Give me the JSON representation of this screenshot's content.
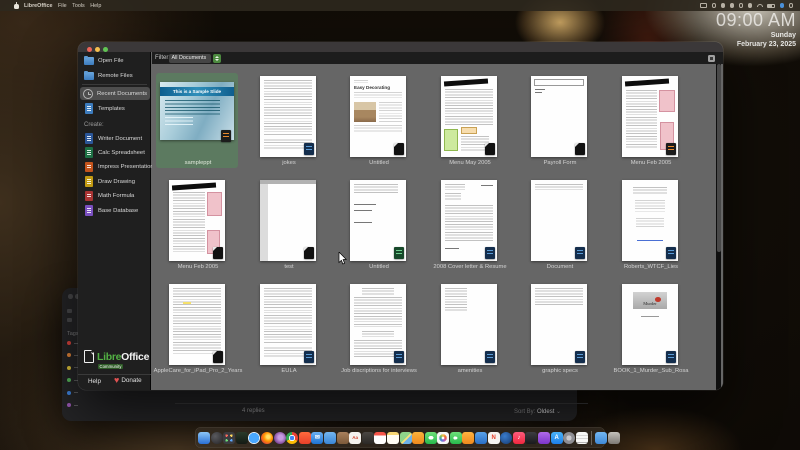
{
  "menu_bar": {
    "items": [
      "LibreOffice",
      "File",
      "Tools",
      "Help"
    ],
    "status_icons": [
      "rect",
      "ring",
      "circ",
      "circ",
      "ring",
      "circ",
      "wifi",
      "batt",
      "blue",
      "ring"
    ]
  },
  "clock": {
    "time": "09:00 AM",
    "day": "Sunday",
    "date": "February 23, 2025"
  },
  "background_window": {
    "tags_label": "Tags",
    "tag_colors": [
      "#e0443e",
      "#e8883a",
      "#e5c93d",
      "#58b95c",
      "#3f84e0",
      "#9b59b6"
    ],
    "replies": "4 replies",
    "sort_label": "Sort By:",
    "sort_value": "Oldest",
    "sort_caret": "⌄"
  },
  "window": {
    "filter": {
      "label": "Filter:",
      "value": "All Documents"
    },
    "sidebar": {
      "items": [
        {
          "label": "Open File",
          "icon": "folder"
        },
        {
          "label": "Remote Files",
          "icon": "folder"
        },
        {
          "label": "Recent Documents",
          "icon": "clock",
          "selected": true
        },
        {
          "label": "Templates",
          "icon": "doc",
          "color": "#3c7cbe"
        }
      ],
      "create_label": "Create:",
      "create_items": [
        {
          "label": "Writer Document",
          "color": "#2a5699"
        },
        {
          "label": "Calc Spreadsheet",
          "color": "#1d7044"
        },
        {
          "label": "Impress Presentation",
          "color": "#c4541c"
        },
        {
          "label": "Draw Drawing",
          "color": "#c29a12"
        },
        {
          "label": "Math Formula",
          "color": "#a83434"
        },
        {
          "label": "Base Database",
          "color": "#7a4fc0"
        }
      ],
      "logo_green": "Libre",
      "logo_white": "Office",
      "community": "Community",
      "help_label": "Help",
      "donate_label": "Donate"
    },
    "documents": [
      {
        "name": "sampleppt",
        "variant": "slide",
        "badge": "impress",
        "selected": true,
        "text": "This is a Sample Slide"
      },
      {
        "name": "jokes",
        "variant": "dense",
        "badge": "writer"
      },
      {
        "name": "Untitled",
        "variant": "easydeco",
        "badge": "plain",
        "text": "Easy Decorating"
      },
      {
        "name": "Menu May 2005",
        "variant": "menumay",
        "badge": "plain"
      },
      {
        "name": "Payroll Form",
        "variant": "payroll",
        "badge": "plain"
      },
      {
        "name": "Menu Feb 2005",
        "variant": "menufeb",
        "badge": "impress"
      },
      {
        "name": "Menu Feb 2005",
        "variant": "menufeb2",
        "badge": "plain"
      },
      {
        "name": "test",
        "variant": "test",
        "badge": "plain"
      },
      {
        "name": "Untitled",
        "variant": "calcsheet",
        "badge": "calc"
      },
      {
        "name": "2008 Cover letter & Resume",
        "variant": "letter",
        "badge": "writer"
      },
      {
        "name": "Document",
        "variant": "sparse",
        "badge": "writer"
      },
      {
        "name": "Roberts_WTCF_Lies",
        "variant": "centered",
        "badge": "writer"
      },
      {
        "name": "AppleCare_for_iPad_Pro_2_Years",
        "variant": "dense2",
        "badge": "plain"
      },
      {
        "name": "EULA",
        "variant": "dense",
        "badge": "writer"
      },
      {
        "name": "Job discriptions for interviews",
        "variant": "densecenter",
        "badge": "writer"
      },
      {
        "name": "amenities",
        "variant": "listshort",
        "badge": "writer"
      },
      {
        "name": "graphic specs",
        "variant": "paratop",
        "badge": "writer"
      },
      {
        "name": "BOOK_1_Murder_Sub_Rosa",
        "variant": "book",
        "badge": "writer",
        "text": "Murder"
      }
    ]
  },
  "dock": {
    "apps": [
      {
        "name": "finder",
        "bg": "linear-gradient(180deg,#8cc6f7,#2a6fd4)"
      },
      {
        "name": "siri",
        "bg": "radial-gradient(circle at 35% 35%,#5a5a5e,#232326)",
        "round": true
      },
      {
        "name": "launchpad",
        "bg": "radial-gradient(1.3px at 30% 30%,#ff6b5e 98%,transparent),radial-gradient(1.3px at 70% 30%,#ffd95e 98%,transparent),radial-gradient(1.3px at 30% 70%,#6ee07a 98%,transparent),radial-gradient(1.3px at 70% 70%,#5ea8ff 98%,transparent),#3c3c40"
      },
      {
        "name": "desktop",
        "bg": "linear-gradient(180deg,#2a3a2a,#141a14)"
      },
      {
        "name": "safari",
        "bg": "radial-gradient(circle,#4aa8ff 0 60%,#e8f2fc 61% 78%,#c9ddf0 79%)",
        "round": true
      },
      {
        "name": "firefox",
        "bg": "radial-gradient(circle at 60% 40%,#ffe066 0 15%,#ff9500 42%,#e3443a 78%,#b5288a 100%)",
        "round": true
      },
      {
        "name": "tor-browser",
        "bg": "radial-gradient(circle at 55% 45%,#c79be0 0 25%,#7d4698 70%,#42235c)",
        "round": true
      },
      {
        "name": "chrome",
        "bg": "radial-gradient(circle,#4285f4 0 26%,#ffffff 27% 36%,transparent 37%),conic-gradient(#ea4335 0 120deg,#fbbc05 120deg 240deg,#34a853 240deg 360deg)",
        "round": true
      },
      {
        "name": "brave",
        "bg": "linear-gradient(180deg,#ff6a3d,#e8402a)"
      },
      {
        "name": "mail",
        "bg": "linear-gradient(180deg,#6ab0f3,#1e73d2)",
        "glyph": "✉",
        "gc": "#fff"
      },
      {
        "name": "app-window",
        "bg": "linear-gradient(180deg,#74b6f0,#3a86d6)"
      },
      {
        "name": "books",
        "bg": "linear-gradient(180deg,#a8805c,#7c5a3a)"
      },
      {
        "name": "dictionary",
        "bg": "#f4f2ee",
        "glyph": "Aa",
        "gc": "#d0452f"
      },
      {
        "name": "photo-booth",
        "bg": "linear-gradient(180deg,#4a4642,#2b2926)"
      },
      {
        "name": "calendar",
        "bg": "linear-gradient(180deg,#f55549 0 30%,#ffffff 31%)"
      },
      {
        "name": "notes",
        "bg": "linear-gradient(180deg,#f7d774 0 26%,#fffdf4 27%)"
      },
      {
        "name": "maps",
        "bg": "linear-gradient(135deg,#8fd48a 0 50%,#f6e27a 50% 60%,#6db2e8 60%)"
      },
      {
        "name": "preferences-grid",
        "bg": "linear-gradient(180deg,#f9b23c,#f08a1d)"
      },
      {
        "name": "messages",
        "bg": "radial-gradient(4px 3px at 50% 48%,#fff 0 60%,transparent 61%),linear-gradient(180deg,#6ee07a,#28b94c)"
      },
      {
        "name": "photos",
        "bg": "radial-gradient(circle at 50% 50%,#ffffff 0 16%,transparent 17% 44%,#f5f5f5 45%),conic-gradient(#f3c14b,#ef8633,#e8574b,#c958ac,#7e6bd6,#4a90d9,#4aa8a0,#8cc152,#f3c14b)"
      },
      {
        "name": "facetime",
        "bg": "radial-gradient(3.5px 2.5px at 45% 50%,#fff 0 60%,transparent 61%),linear-gradient(180deg,#6ee07a,#28b94c)"
      },
      {
        "name": "pencil-app",
        "bg": "linear-gradient(180deg,#ffb340,#f08a1d)"
      },
      {
        "name": "blue-doc",
        "bg": "linear-gradient(180deg,#5aa2e8,#2a6fc4)"
      },
      {
        "name": "news",
        "bg": "#f6f4f0",
        "glyph": "N",
        "gc": "#e8402a"
      },
      {
        "name": "dark-blue-app",
        "bg": "radial-gradient(circle at 40% 35%,#3a7ccc,#153a6e)",
        "round": true
      },
      {
        "name": "music",
        "bg": "linear-gradient(180deg,#fc5c7d,#f2273e)",
        "glyph": "♪",
        "gc": "#fff"
      },
      {
        "name": "tv",
        "bg": "linear-gradient(180deg,#3c3c40,#1a1a1c)"
      },
      {
        "name": "podcasts",
        "bg": "linear-gradient(180deg,#b06ae8,#7d35c9)"
      },
      {
        "name": "app-store",
        "bg": "linear-gradient(180deg,#4ab3f8,#1d7fe8)",
        "glyph": "A",
        "gc": "#fff"
      },
      {
        "name": "system-settings",
        "bg": "radial-gradient(circle at 50% 50%,#c8c8cc 0 30%,#8e8e93 31% 70%,#6a6a6e)",
        "round": true
      },
      {
        "name": "textedit",
        "bg": "repeating-linear-gradient(to bottom,transparent 0 3px,#b5b5b5 3px 3.6px),#f7f7f5"
      },
      {
        "name": "separator",
        "sep": true
      },
      {
        "name": "downloads-folder",
        "bg": "linear-gradient(180deg,#73b7f2,#3f8ad9)"
      },
      {
        "name": "trash",
        "bg": "linear-gradient(180deg,rgba(205,202,196,.95),rgba(132,130,126,.92))"
      }
    ]
  }
}
